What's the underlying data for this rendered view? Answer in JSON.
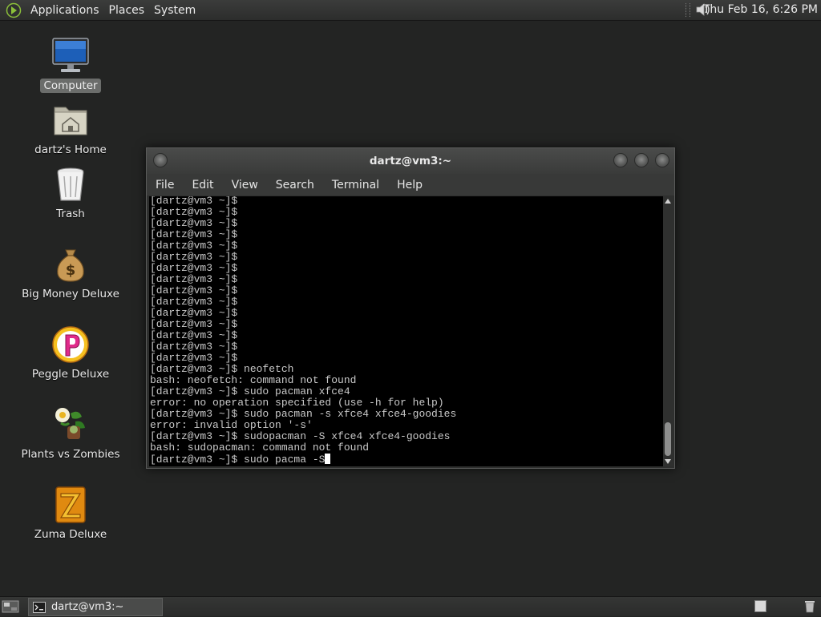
{
  "top_panel": {
    "menus": [
      "Applications",
      "Places",
      "System"
    ],
    "clock": "Thu Feb 16,  6:26 PM"
  },
  "desktop_icons": [
    {
      "label": "Computer",
      "icon": "computer-icon",
      "selected": true
    },
    {
      "label": "dartz's Home",
      "icon": "home-folder-icon",
      "selected": false
    },
    {
      "label": "Trash",
      "icon": "trash-icon",
      "selected": false
    },
    {
      "label": "Big Money Deluxe",
      "icon": "money-bag-icon",
      "selected": false
    },
    {
      "label": "Peggle Deluxe",
      "icon": "peggle-icon",
      "selected": false
    },
    {
      "label": "Plants vs Zombies",
      "icon": "plants-vs-zombies-icon",
      "selected": false
    },
    {
      "label": "Zuma Deluxe",
      "icon": "zuma-icon",
      "selected": false
    }
  ],
  "terminal": {
    "title": "dartz@vm3:~",
    "menus": [
      "File",
      "Edit",
      "View",
      "Search",
      "Terminal",
      "Help"
    ],
    "lines": [
      "[dartz@vm3 ~]$",
      "[dartz@vm3 ~]$",
      "[dartz@vm3 ~]$",
      "[dartz@vm3 ~]$",
      "[dartz@vm3 ~]$",
      "[dartz@vm3 ~]$",
      "[dartz@vm3 ~]$",
      "[dartz@vm3 ~]$",
      "[dartz@vm3 ~]$",
      "[dartz@vm3 ~]$",
      "[dartz@vm3 ~]$",
      "[dartz@vm3 ~]$",
      "[dartz@vm3 ~]$",
      "[dartz@vm3 ~]$",
      "[dartz@vm3 ~]$",
      "[dartz@vm3 ~]$ neofetch",
      "bash: neofetch: command not found",
      "[dartz@vm3 ~]$ sudo pacman xfce4",
      "error: no operation specified (use -h for help)",
      "[dartz@vm3 ~]$ sudo pacman -s xfce4 xfce4-goodies",
      "error: invalid option '-s'",
      "[dartz@vm3 ~]$ sudopacman -S xfce4 xfce4-goodies",
      "bash: sudopacman: command not found"
    ],
    "current_input": "[dartz@vm3 ~]$ sudo pacma -S"
  },
  "taskbar": {
    "window_label": "dartz@vm3:~"
  },
  "colors": {
    "desktop_bg": "#232423",
    "terminal_bg": "#000000",
    "terminal_fg": "#c9c9c9"
  }
}
